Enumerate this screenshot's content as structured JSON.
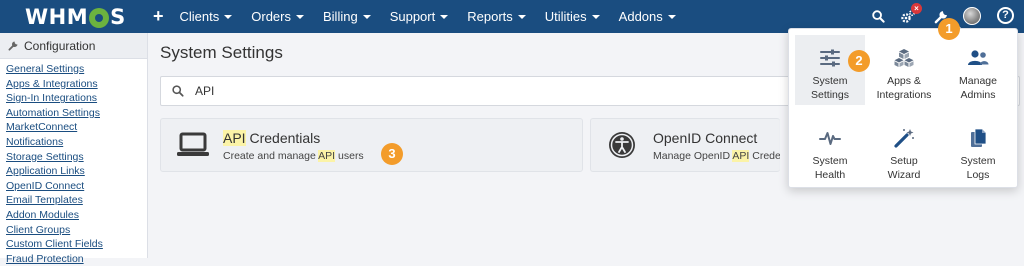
{
  "brand": {
    "logo_prefix": "WHM",
    "logo_suffix": "S"
  },
  "nav": {
    "plus": "+",
    "items": [
      "Clients",
      "Orders",
      "Billing",
      "Support",
      "Reports",
      "Utilities",
      "Addons"
    ]
  },
  "notification_badge": "×",
  "help_icon_label": "?",
  "sidebar": {
    "title": "Configuration",
    "links": [
      "General Settings",
      "Apps & Integrations",
      "Sign-In Integrations",
      "Automation Settings",
      "MarketConnect",
      "Notifications",
      "Storage Settings",
      "Application Links",
      "OpenID Connect",
      "Email Templates",
      "Addon Modules",
      "Client Groups",
      "Custom Client Fields",
      "Fraud Protection"
    ]
  },
  "main": {
    "title": "System Settings",
    "search_value": "API",
    "results": [
      {
        "title_hl": "API",
        "title_rest": " Credentials",
        "sub_pre": "Create and manage ",
        "sub_hl": "API",
        "sub_post": " users"
      },
      {
        "title": "OpenID Connect",
        "sub_pre": "Manage OpenID ",
        "sub_hl": "API",
        "sub_post": " Credentials"
      }
    ]
  },
  "dropdown": {
    "items": [
      {
        "label": "System Settings",
        "line1": "System",
        "line2": "Settings",
        "icon": "sliders-icon"
      },
      {
        "label": "Apps & Integrations",
        "line1": "Apps &",
        "line2": "Integrations",
        "icon": "cubes-icon"
      },
      {
        "label": "Manage Admins",
        "line1": "Manage",
        "line2": "Admins",
        "icon": "users-icon"
      },
      {
        "label": "System Health",
        "line1": "System",
        "line2": "Health",
        "icon": "heartbeat-icon"
      },
      {
        "label": "Setup Wizard",
        "line1": "Setup",
        "line2": "Wizard",
        "icon": "magic-wand-icon"
      },
      {
        "label": "System Logs",
        "line1": "System",
        "line2": "Logs",
        "icon": "documents-icon"
      }
    ]
  },
  "steps": [
    "1",
    "2",
    "3"
  ],
  "colors": {
    "topbar": "#1a4d80",
    "accent_step": "#f39c2a",
    "highlight": "#fbf3a7",
    "link": "#1a4d80"
  }
}
